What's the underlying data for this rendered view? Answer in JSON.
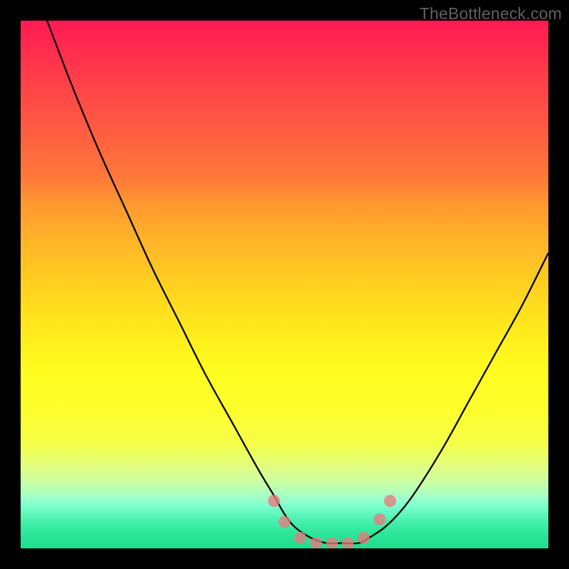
{
  "watermark": "TheBottleneck.com",
  "chart_data": {
    "type": "line",
    "title": "",
    "xlabel": "",
    "ylabel": "",
    "xlim": [
      0,
      100
    ],
    "ylim": [
      0,
      100
    ],
    "series": [
      {
        "name": "bottleneck-curve",
        "x": [
          5,
          10,
          15,
          20,
          25,
          30,
          35,
          40,
          45,
          48,
          50,
          52,
          55,
          58,
          61,
          64,
          66,
          69,
          72,
          75,
          80,
          85,
          90,
          95,
          100
        ],
        "values": [
          100,
          87,
          75,
          64,
          53,
          43,
          33,
          24,
          15,
          10,
          6.5,
          4,
          2,
          1,
          1,
          1,
          2,
          4,
          7,
          11,
          19,
          28,
          37,
          46,
          56
        ]
      }
    ],
    "markers": {
      "name": "highlight-dots",
      "x": [
        48,
        50,
        53,
        56,
        59,
        62,
        65,
        68,
        70
      ],
      "values": [
        9,
        5,
        2,
        1,
        1,
        1,
        2,
        5.5,
        9
      ]
    },
    "colors": {
      "curve": "#000000",
      "markers": "#e97a7f",
      "background_top": "#ff1a52",
      "background_bottom": "#1fdd8c"
    }
  }
}
